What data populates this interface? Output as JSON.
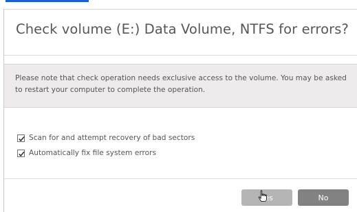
{
  "dialog": {
    "title": "Check volume (E:) Data Volume, NTFS for errors?",
    "note": "Please note that check operation needs exclusive access to the volume. You may be asked to restart your computer to complete the operation.",
    "options": [
      {
        "label": "Scan for and attempt recovery of bad sectors",
        "checked": true
      },
      {
        "label": "Automatically fix file system errors",
        "checked": true
      }
    ],
    "buttons": {
      "yes_label": "Yes",
      "no_label": "No"
    }
  },
  "colors": {
    "title_text": "#565656",
    "note_background": "#eeebec",
    "yes_button": "#b5b5b5",
    "no_button": "#828282",
    "link_underline": "#1a5fd0"
  }
}
